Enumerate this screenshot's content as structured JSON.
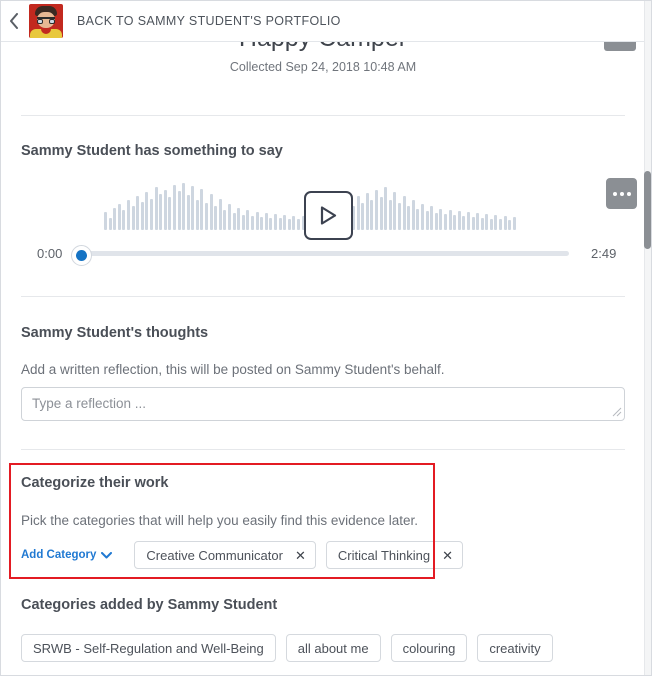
{
  "header": {
    "back_icon": "chevron-left-icon",
    "avatar_alt": "Sammy Student avatar",
    "breadcrumb": "BACK TO SAMMY STUDENT'S PORTFOLIO"
  },
  "evidence": {
    "title": "Happy Camper",
    "collected": "Collected Sep 24, 2018 10:48 AM",
    "menu_icon": "overflow-menu-icon"
  },
  "audio": {
    "heading": "Sammy Student has something to say",
    "play_icon": "play-icon",
    "menu_icon": "ellipsis-icon",
    "current_time": "0:00",
    "total_time": "2:49",
    "progress_percent": 0,
    "waveform": [
      18,
      12,
      22,
      26,
      20,
      30,
      24,
      34,
      28,
      38,
      31,
      43,
      36,
      40,
      33,
      45,
      39,
      47,
      35,
      44,
      30,
      41,
      27,
      36,
      24,
      31,
      20,
      26,
      17,
      22,
      15,
      20,
      14,
      18,
      13,
      17,
      12,
      16,
      12,
      15,
      11,
      14,
      11,
      14,
      12,
      16,
      13,
      19,
      15,
      22,
      18,
      26,
      21,
      30,
      24,
      34,
      27,
      37,
      30,
      40,
      33,
      43,
      30,
      38,
      27,
      34,
      24,
      30,
      21,
      26,
      19,
      24,
      17,
      21,
      16,
      20,
      15,
      19,
      14,
      18,
      13,
      17,
      12,
      16,
      11,
      15,
      11,
      14,
      10,
      13
    ],
    "colors": {
      "wave": "#ced6e0",
      "handle": "#1573c4",
      "play_border": "#3c4250"
    }
  },
  "reflection": {
    "heading": "Sammy Student's thoughts",
    "subtext": "Add a written reflection, this will be posted on Sammy Student's behalf.",
    "placeholder": "Type a reflection ...",
    "value": ""
  },
  "categorize": {
    "heading": "Categorize their work",
    "subtext": "Pick the categories that will help you easily find this evidence later.",
    "add_button_label": "Add Category",
    "add_button_icon": "chevron-down-icon",
    "highlight_color": "#e31b23",
    "chips": [
      {
        "label": "Creative Communicator",
        "remove_icon": "close-icon"
      },
      {
        "label": "Critical Thinking",
        "remove_icon": "close-icon"
      }
    ]
  },
  "student_categories": {
    "heading": "Categories added by Sammy Student",
    "tags": [
      "SRWB - Self-Regulation and Well-Being",
      "all about me",
      "colouring",
      "creativity"
    ]
  },
  "scrollbar": {
    "thumb_position_percent": 25
  }
}
